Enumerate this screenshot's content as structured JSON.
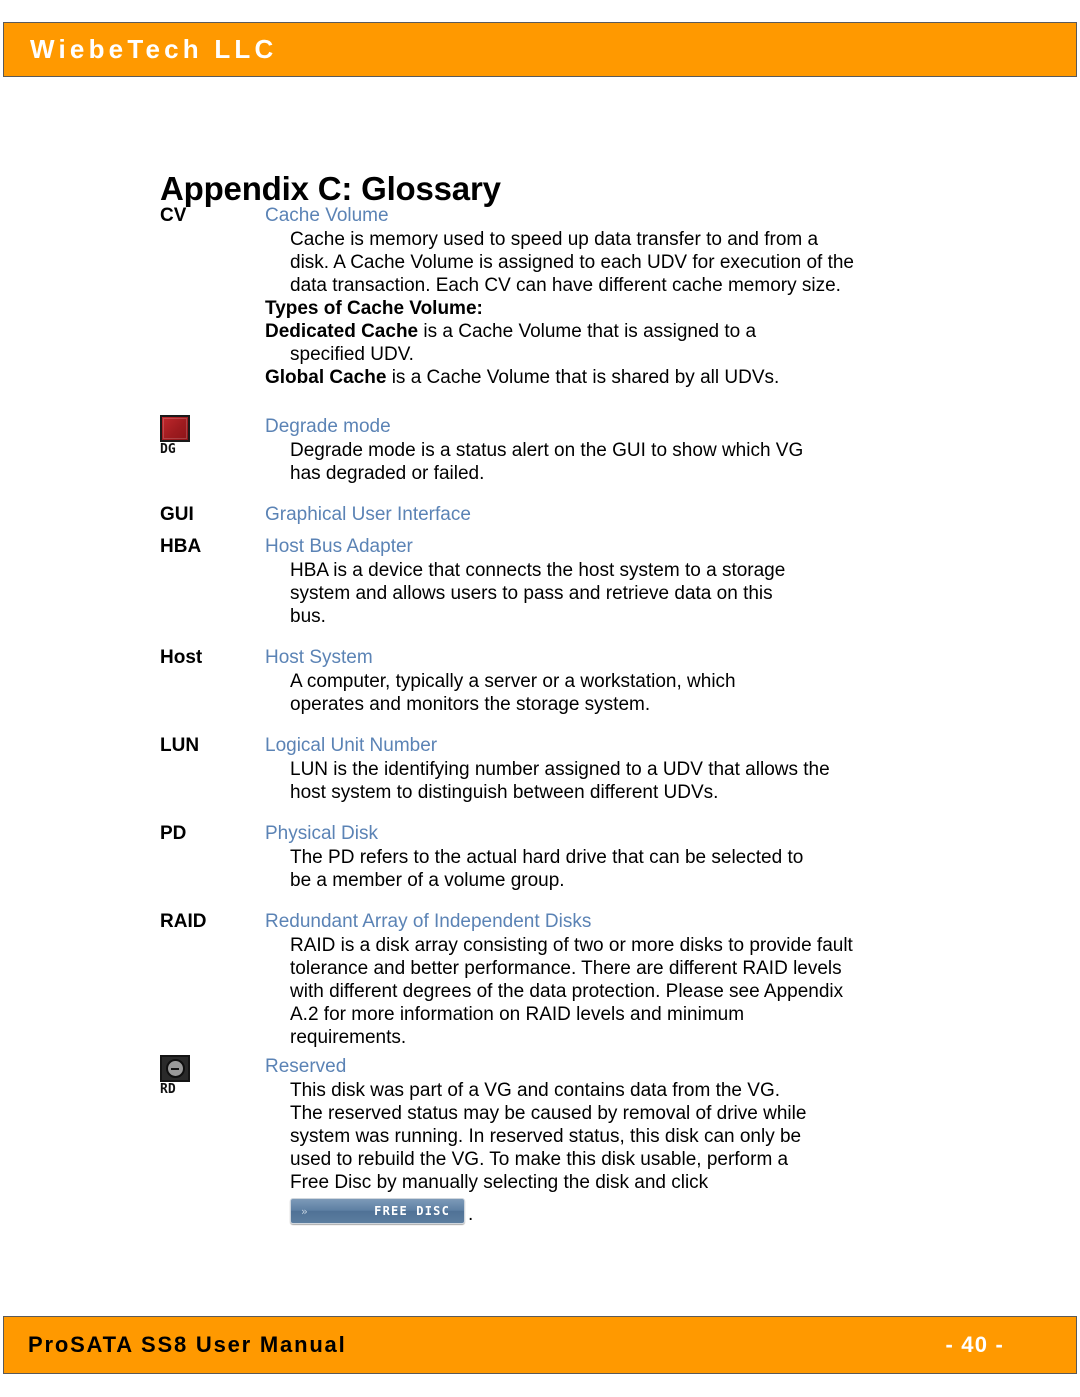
{
  "header": {
    "company": "WiebeTech LLC",
    "band_color": "#ff9900"
  },
  "page_title": "Appendix C: Glossary",
  "accent_blue": "#5b83b5",
  "glossary": {
    "entries": [
      {
        "term": "CV",
        "icon": null,
        "title": "Cache Volume",
        "body_lines": [
          "Cache is memory used to speed up data transfer to and from a",
          "disk. A Cache Volume is assigned to each UDV for execution of the",
          "data transaction. Each CV can have different cache memory size."
        ],
        "extra_lines": [
          "Types of Cache Volume:",
          "Dedicated Cache is a Cache Volume that is assigned to a",
          "specified UDV.",
          "Global Cache is a Cache Volume that is shared by all UDVs."
        ]
      },
      {
        "term": "",
        "icon": "degrade-mode-icon",
        "icon_code": "DG",
        "title": "Degrade mode",
        "body_lines": [
          "Degrade mode is a status alert on the GUI to show which VG",
          "has degraded or failed."
        ]
      },
      {
        "term": "GUI",
        "icon": null,
        "title": "Graphical User Interface",
        "body_lines": []
      },
      {
        "term": "HBA",
        "icon": null,
        "title": "Host Bus Adapter",
        "body_lines": [
          "HBA is a device that connects the host system to a storage",
          "system and allows users to pass and retrieve data on this",
          "bus."
        ]
      },
      {
        "term": "Host",
        "icon": null,
        "title": "Host System",
        "body_lines": [
          "A computer, typically a server or a workstation, which",
          "operates and monitors the storage system."
        ]
      },
      {
        "term": "LUN",
        "icon": null,
        "title": "Logical Unit Number",
        "body_lines": [
          "LUN is the identifying number assigned to a UDV that allows the",
          "host system to distinguish between different UDVs."
        ]
      },
      {
        "term": "PD",
        "icon": null,
        "title": "Physical Disk",
        "body_lines": [
          "The PD refers to the actual hard drive that can be selected to",
          "be a member of a volume group."
        ]
      },
      {
        "term": "RAID",
        "icon": null,
        "title": "Redundant Array of Independent Disks",
        "body_lines": [
          "RAID is a disk array consisting of two or more disks to provide fault",
          "tolerance and better performance. There are different RAID levels",
          "with different degrees of the data protection.  Please see Appendix",
          "A.2 for more information on RAID levels and minimum",
          "requirements."
        ]
      },
      {
        "term": "",
        "icon": "reserved-icon",
        "icon_code": "RD",
        "title": "Reserved",
        "body_lines": [
          "This disk was part of a VG and contains data from the VG.",
          "The reserved status may be caused by removal of drive while",
          "system was running. In reserved status, this disk can only be",
          "used to rebuild the VG. To make this disk usable, perform a",
          "Free Disc by manually selecting the disk and click"
        ],
        "button": {
          "chevron": "»",
          "label": "FREE DISC",
          "trailing_period": "."
        }
      }
    ]
  },
  "footer": {
    "manual_title": "ProSATA SS8 User Manual",
    "page_number": "- 40 -"
  }
}
